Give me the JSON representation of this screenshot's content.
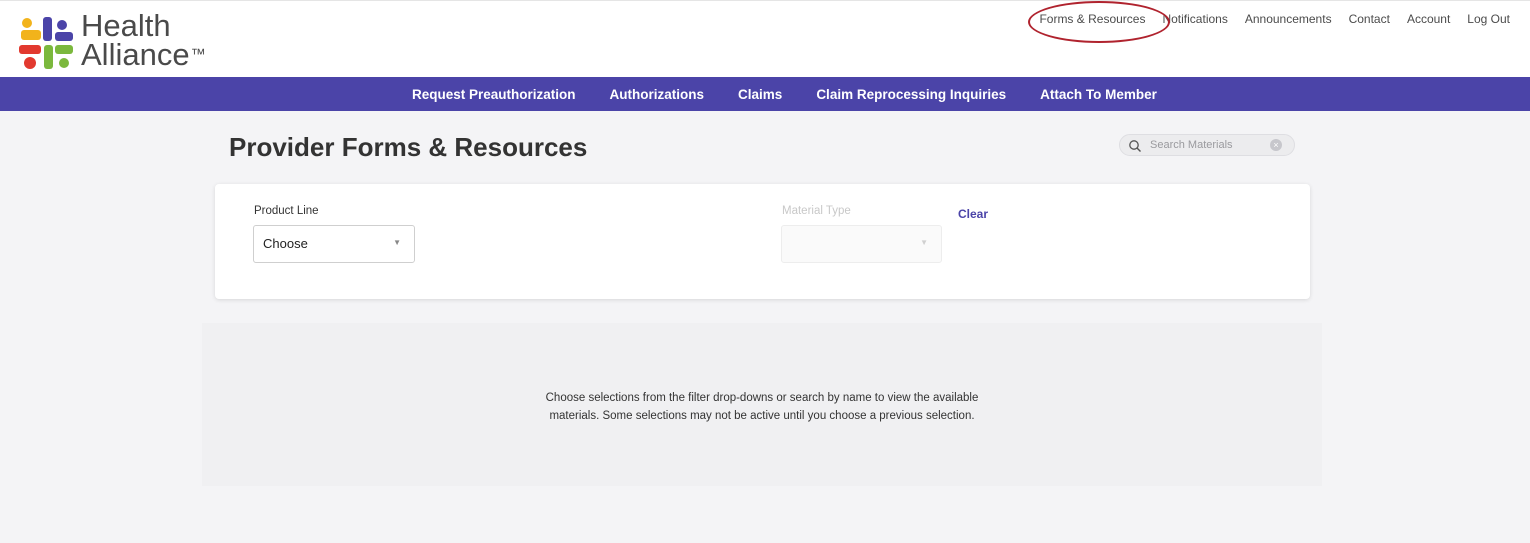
{
  "brand": {
    "name_line1": "Health",
    "name_line2": "Alliance",
    "trademark": "™",
    "accent_color": "#4b44a8"
  },
  "top_nav": {
    "items": [
      "Forms & Resources",
      "Notifications",
      "Announcements",
      "Contact",
      "Account",
      "Log Out"
    ],
    "highlight_color": "#b0232e"
  },
  "main_nav": {
    "items": [
      "Request Preauthorization",
      "Authorizations",
      "Claims",
      "Claim Reprocessing Inquiries",
      "Attach To Member"
    ]
  },
  "page": {
    "title": "Provider Forms & Resources"
  },
  "search": {
    "placeholder": "Search Materials"
  },
  "filters": {
    "product_line": {
      "label": "Product Line",
      "value": "Choose"
    },
    "material_type": {
      "label": "Material Type",
      "value": ""
    },
    "clear_label": "Clear"
  },
  "empty_state": {
    "line1": "Choose selections from the filter drop-downs or search by name to view the available",
    "line2": "materials. Some selections may not be active until you choose a previous selection."
  }
}
